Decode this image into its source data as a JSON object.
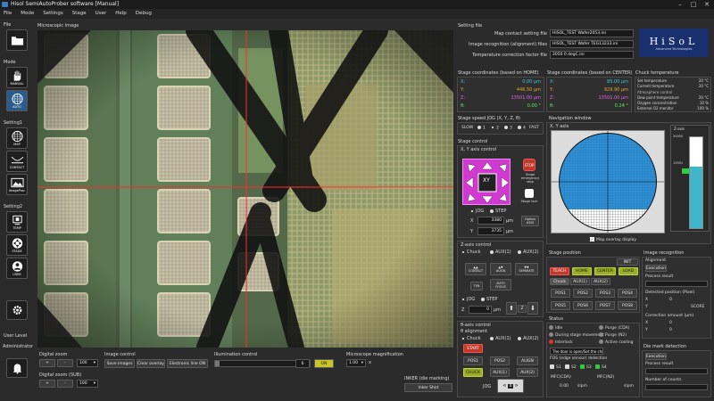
{
  "window": {
    "title": "Hisol SemiAutoProber software [Manual]"
  },
  "menu": [
    "File",
    "Mode",
    "Settings",
    "Stage",
    "User",
    "Help",
    "Debug"
  ],
  "sidebar": {
    "file_label": "File",
    "mode_label": "Mode",
    "manual_label": "MANUAL",
    "auto_label": "AUTO",
    "setting1_label": "Setting1",
    "map_label": "MAP",
    "contact_label": "CONTACT",
    "image_label": "ImageProc",
    "setting2_label": "Setting2",
    "temp_label": "TEMP",
    "stage_label": "STAGE",
    "user_label": "USER",
    "user_level_label": "User Level",
    "user_level_value": "Administrator"
  },
  "microscope": {
    "label": "Microscopic image"
  },
  "bottom": {
    "digital_zoom_label": "Digital zoom",
    "digital_zoom_value": "100",
    "digital_zoom_sub_label": "Digital zoom (SUB)",
    "digital_zoom_sub_value": "100",
    "image_control_label": "Image control",
    "save_images": "Save images",
    "clear_overlay": "Clear overlay",
    "electronic_line": "Electronic line ON",
    "illumination_label": "Illumination control",
    "illumination_value": "6",
    "illumination_on": "ON",
    "illumination_level": 0.05,
    "magnification_label": "Microscope magnification",
    "magnification_value": "1.00",
    "magnification_unit": "x",
    "inker_label": "INKER (die marking)",
    "inker_shot": "Inker Shot",
    "plus": "+",
    "minus": "-"
  },
  "setting_file": {
    "label": "Setting file",
    "rows": [
      {
        "name": "Map contact setting file",
        "value": "HISOL_TEST Wafer2053.ini"
      },
      {
        "name": "Image recognition (alignment) files",
        "value": "HISOL_TEST Wafer TEG13233.ini"
      },
      {
        "name": "Temperature correction factor file",
        "value": "2050 0 degC.ini"
      }
    ],
    "logo_text": "HiSoL",
    "logo_sub": "Advanced Technologies"
  },
  "stage_home": {
    "label": "Stage coordinates (based on HOME)",
    "x": "0.00 µm",
    "y": "446.50 µm",
    "z": "13501.00 µm",
    "th": "0.00 °"
  },
  "stage_center": {
    "label": "Stage coordinates (based on CENTER)",
    "x": "85.00 µm",
    "y": "929.90 µm",
    "z": "13501.00 µm",
    "th": "0.24 °"
  },
  "chuck_temp": {
    "label": "Chuck temperature",
    "set_label": "Set temperature",
    "set_value": "20 °C",
    "cur_label": "Current temperature",
    "cur_value": "20 °C",
    "atm_label": "Atmosphere control",
    "dew_label": "Dew point temperature",
    "dew_value": "20 °C",
    "oxy_label": "Oxygen concentration",
    "oxy_value": "10 %",
    "ext_label": "External O2 monitor",
    "ext_value": "100 %"
  },
  "speed": {
    "label": "Stage speed JOG (X, Y, Z, θ)",
    "slow": "SLOW",
    "fast": "FAST",
    "levels": [
      "1",
      "2",
      "3",
      "4"
    ],
    "selected": 2
  },
  "stage_control": {
    "label": "Stage control",
    "xy_label": "X, Y axis control",
    "xy_center": "XY",
    "jog": "JOG",
    "step": "STEP",
    "stop_label": "Stage emergency stop",
    "lock_label": "Stage lock",
    "option_axis": "Option AXIS",
    "x_value": "3380",
    "y_value": "3735",
    "unit": "µm",
    "z_label": "Z-axis control",
    "chuck": "Chuck",
    "aux1": "AUX(1)",
    "aux2": "AUX(2)",
    "contact": "CONTACT",
    "align": "ALIGN",
    "separate": "SEPARATE",
    "ten": "TEN",
    "auto_focus": "AUTO FOCUS",
    "z_step_value": "0",
    "theta_label": "θ-axis control",
    "theta_align": "θ alignment",
    "start": "START",
    "pos1": "POS1",
    "pos2": "POS2",
    "align_btn": "ALIGN",
    "chuck_btn": "CHUCK",
    "jog_value": "0"
  },
  "nav": {
    "label": "Navigation window",
    "axis_label": "X, Y axis",
    "z_axis_label": "Z-axis",
    "z_top": "20000",
    "z_mark": "13501",
    "z_level": 0.675,
    "overlay": "Map overlay display"
  },
  "stage_position": {
    "label": "Stage position",
    "init": "INIT",
    "teach": "TEACH",
    "home": "HOME",
    "center": "CENTER",
    "load": "LOAD",
    "tabs": [
      "Chuck",
      "AUX(1)",
      "AUX(2)"
    ],
    "pos": [
      "POS1",
      "POS2",
      "POS3",
      "POS4",
      "POS5",
      "POS6",
      "POS7",
      "POS8"
    ]
  },
  "status": {
    "label": "Status",
    "idle": "Idle",
    "purge_cda": "Purge (CDA)",
    "during_move": "During stage movement",
    "purge_n2": "Purge (N2)",
    "interlock": "Interlock",
    "active_cooling": "Active cooling",
    "door_msg": "The door is open/Set the chuck",
    "fos_label": "FOS (edge sensor) detection",
    "s1": "S1",
    "s2": "S2",
    "s3": "S3",
    "s4": "S4",
    "mfc_cda_label": "MFC(CDA)",
    "mfc_cda_value": "0.00",
    "mfc_unit": "slpm",
    "mfc_n2_label": "MFC(N2)",
    "mfc_n2_unit": "slpm"
  },
  "image_recog": {
    "label": "Image recognition",
    "align_label": "Alignment",
    "exec": "Execution",
    "process_result": "Process result",
    "detected_pos": "Detected position (Pixel)",
    "x": "X",
    "x_val": "0",
    "y": "Y",
    "score": "SCORE",
    "corr": "Correction amount (µm)",
    "cx_val": "0",
    "cy_val": "0",
    "die_label": "Die mark detection",
    "die_exec": "Execution",
    "die_result": "Process result",
    "count_label": "Number of counts"
  },
  "colors": {
    "accent_green": "#9aae2a",
    "stop_red": "#c0392b",
    "wafer_blue": "#2f8fd3",
    "xy_magenta": "#d13ad1"
  }
}
